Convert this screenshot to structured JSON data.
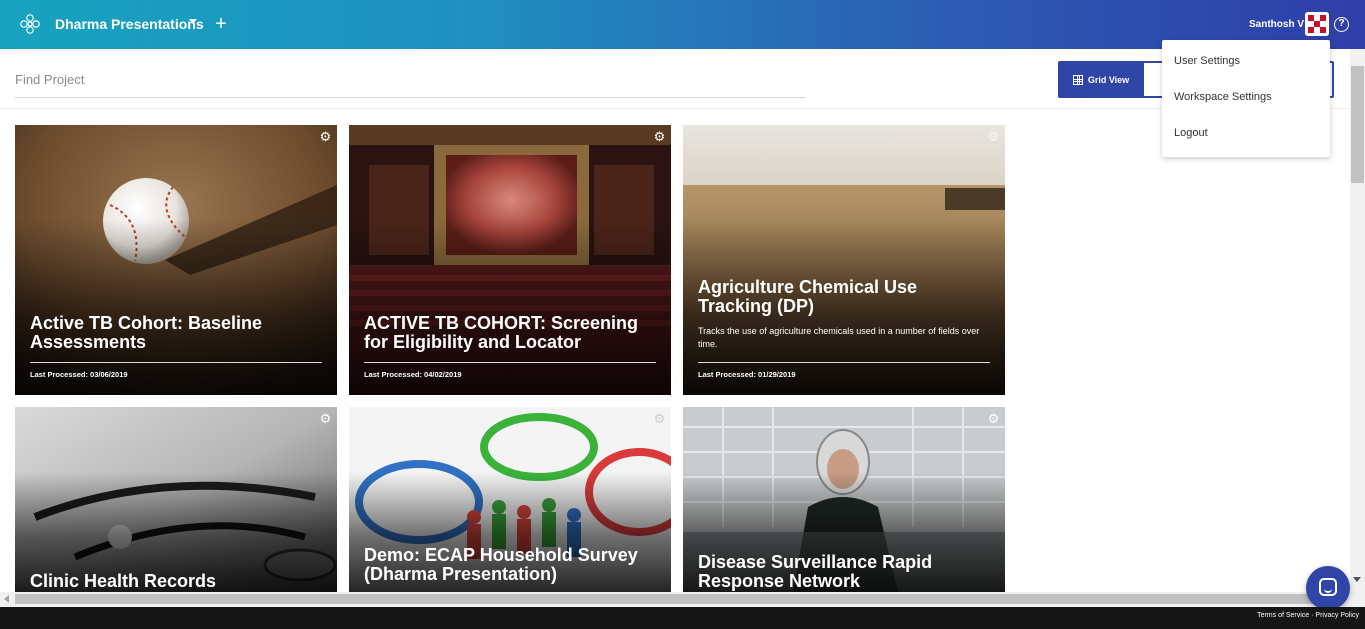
{
  "header": {
    "workspace_title": "Dharma Presentations",
    "user_name": "Santhosh V",
    "add_icon": "plus-icon",
    "help_icon": "question-circle-icon",
    "brand_gradient": [
      "#17a3bf",
      "#2f3ea8"
    ]
  },
  "search": {
    "placeholder": "Find Project"
  },
  "view_toggle": {
    "grid_label": "Grid View",
    "accent": "#2f46a6"
  },
  "user_menu": {
    "items": [
      {
        "label": "User Settings"
      },
      {
        "label": "Workspace Settings"
      },
      {
        "label": "Logout"
      }
    ]
  },
  "projects": [
    {
      "title": "Active TB Cohort: Baseline Assessments",
      "description": "",
      "last_processed": "Last Processed: 03/06/2019",
      "image": "baseball-on-dirt"
    },
    {
      "title": "ACTIVE TB COHORT: Screening for Eligibility and Locator",
      "description": "",
      "last_processed": "Last Processed: 04/02/2019",
      "image": "theater-stage"
    },
    {
      "title": "Agriculture Chemical Use Tracking (DP)",
      "description": "Tracks the use of agriculture chemicals used in a number of fields over time.",
      "last_processed": "Last Processed: 01/29/2019",
      "image": "wheat-field"
    },
    {
      "title": "Clinic Health Records",
      "description": "",
      "last_processed": "",
      "image": "stethoscope"
    },
    {
      "title": "Demo: ECAP Household Survey (Dharma Presentation)",
      "description": "",
      "last_processed": "",
      "image": "speech-bubbles-people"
    },
    {
      "title": "Disease Surveillance Rapid Response Network",
      "description": "",
      "last_processed": "",
      "image": "hazmat-worker"
    }
  ],
  "footer": {
    "terms": "Terms of Service",
    "privacy": "Privacy Policy"
  }
}
